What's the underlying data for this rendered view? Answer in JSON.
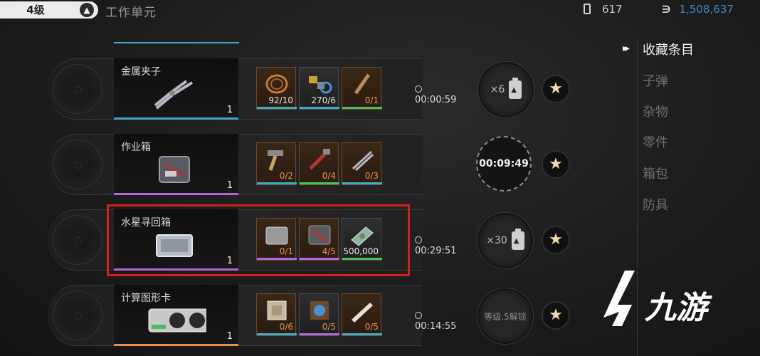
{
  "header": {
    "level": "4级",
    "title": "工作单元",
    "power": "617",
    "coins": "1,508,637"
  },
  "recipes": [
    {
      "name": "金属夹子",
      "count": "1",
      "materials": [
        {
          "qty": "92/10",
          "short": false,
          "bar": "#3fa9c9"
        },
        {
          "qty": "270/6",
          "short": false,
          "bar": "#3fa9c9"
        },
        {
          "qty": "0/1",
          "short": true,
          "bar": "#4bbf5a"
        }
      ],
      "time": "00:00:59",
      "dial": {
        "kind": "battery",
        "count": "×6"
      }
    },
    {
      "name": "作业箱",
      "count": "1",
      "materials": [
        {
          "qty": "0/2",
          "short": true,
          "bar": "#3fa9c9"
        },
        {
          "qty": "0/4",
          "short": true,
          "bar": "#4bbf5a"
        },
        {
          "qty": "0/3",
          "short": true,
          "bar": "#3fa9c9"
        }
      ],
      "time": "",
      "dial": {
        "kind": "clock",
        "time": "00:09:49"
      }
    },
    {
      "name": "水星寻回箱",
      "count": "1",
      "materials": [
        {
          "qty": "0/1",
          "short": true,
          "bar": "#b466d6"
        },
        {
          "qty": "4/5",
          "short": true,
          "bar": "#b466d6"
        },
        {
          "qty": "500,000",
          "short": false,
          "bar": "#4bbf5a"
        }
      ],
      "time": "00:29:51",
      "dial": {
        "kind": "battery",
        "count": "×30"
      }
    },
    {
      "name": "计算图形卡",
      "count": "1",
      "materials": [
        {
          "qty": "0/6",
          "short": true,
          "bar": "#3fa9c9"
        },
        {
          "qty": "0/5",
          "short": true,
          "bar": "#b466d6"
        },
        {
          "qty": "0/5",
          "short": true,
          "bar": "#3fa9c9"
        }
      ],
      "time": "00:14:55",
      "dial": {
        "kind": "locked",
        "text": "等级.5解锁"
      }
    }
  ],
  "categories": [
    "收藏条目",
    "子弹",
    "杂物",
    "零件",
    "箱包",
    "防具"
  ],
  "active_category": "收藏条目",
  "watermark": "九游",
  "colors": {
    "highlight": "#d21f1f",
    "accent_blue": "#3fa9c9",
    "accent_purple": "#b466d6",
    "accent_green": "#4bbf5a",
    "coin_blue": "#3f87c9",
    "short_qty": "#e8914a"
  }
}
